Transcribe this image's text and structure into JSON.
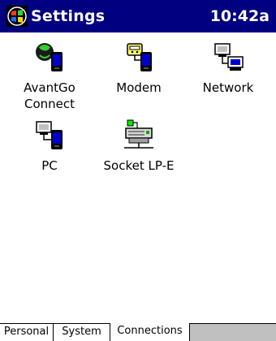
{
  "titlebar": {
    "app_title": "Settings",
    "clock": "10:42a",
    "start_icon": "windows-flag-icon"
  },
  "icons": [
    {
      "label": "AvantGo\nConnect",
      "icon": "avantgo-icon"
    },
    {
      "label": "Modem",
      "icon": "modem-icon"
    },
    {
      "label": "Network",
      "icon": "network-icon"
    },
    {
      "label": "PC",
      "icon": "pc-icon"
    },
    {
      "label": "Socket LP-E",
      "icon": "socket-lpe-icon"
    }
  ],
  "tabs": [
    {
      "label": "Personal",
      "active": false
    },
    {
      "label": "System",
      "active": false
    },
    {
      "label": "Connections",
      "active": true
    }
  ],
  "colors": {
    "titlebar_bg": "#000080",
    "titlebar_text": "#ffffff",
    "tabstrip_bg": "#c0c0c0"
  }
}
